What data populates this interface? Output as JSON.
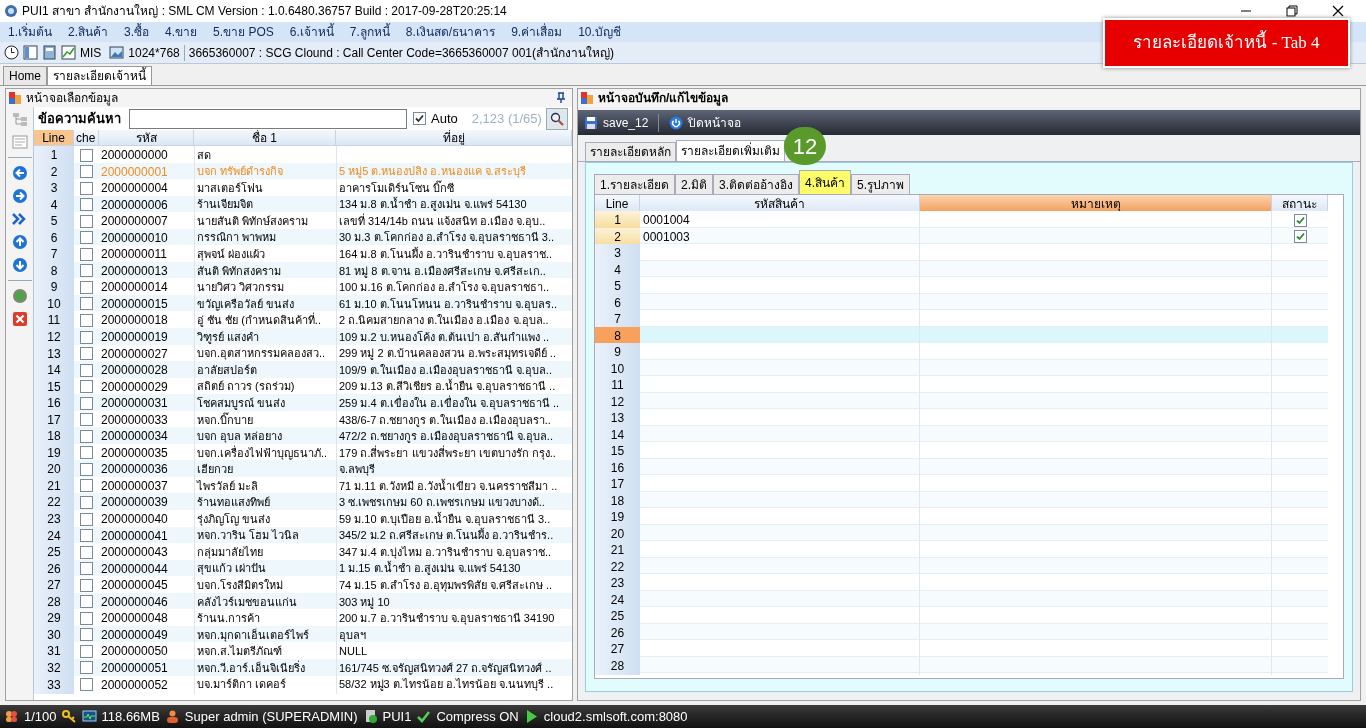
{
  "window": {
    "title": "PUI1 สาขา สำนักงานใหญ่ : SML CM Version : 1.0.6480.36757  Build : 2017-09-28T20:25:14"
  },
  "menu": [
    "1.เริ่มต้น",
    "2.สินค้า",
    "3.ซื้อ",
    "4.ขาย",
    "5.ขาย POS",
    "6.เจ้าหนี้",
    "7.ลูกหนี้",
    "8.เงินสด/ธนาคาร",
    "9.ค่าเสื่อม",
    "10.บัญชี"
  ],
  "toolbar": {
    "mis": "MIS",
    "resolution": "1024*768",
    "info": "3665360007 : SCG Clound : Call Center Code=3665360007 001(สำนักงานใหญ่)"
  },
  "banner": "รายละเอียดเจ้าหนี้ - Tab 4",
  "tabs": [
    {
      "label": "Home",
      "selected": false
    },
    {
      "label": "รายละเอียดเจ้าหนี้",
      "selected": true
    }
  ],
  "left_panel": {
    "title": "หน้าจอเลือกข้อมูล",
    "search_label": "ข้อความค้นหา",
    "auto": {
      "label": "Auto",
      "checked": true
    },
    "count": "2,123 (1/65)",
    "columns": [
      "Line",
      "che",
      "รหัส",
      "ชื่อ 1",
      "ที่อยู่"
    ],
    "rows": [
      {
        "line": "1",
        "code": "2000000000",
        "name": "สด",
        "checked": false,
        "selected": false
      },
      {
        "line": "2",
        "code": "2000000001",
        "name": "บจก ทรัพย์ดำรงกิจ",
        "address": "5 หมู่5 ต.หนองปลิง อ.หนองแค จ.สระบุรี",
        "checked": false,
        "selected": true
      },
      {
        "line": "3",
        "code": "2000000004",
        "name": "มาสเตอร์โฟน",
        "address": "อาคารโมเดิร์นโซน  บิ๊กซี",
        "checked": false,
        "selected": false
      },
      {
        "line": "4",
        "code": "2000000006",
        "name": "ร้านเจียมจิต",
        "address": "134 ม.8 ต.น้ำชำ อ.สูงเม่น จ.แพร่ 54130",
        "checked": false,
        "selected": false
      },
      {
        "line": "5",
        "code": "2000000007",
        "name": "นายสันติ พิทักษ์สงคราม",
        "address": "เลขที่ 314/14b ถนน แจ้งสนิท อ.เมือง จ.อุบ..",
        "checked": false,
        "selected": false
      },
      {
        "line": "6",
        "code": "2000000010",
        "name": "กรรณิกา พาพหม",
        "address": "30 ม.3 ต.โคกก่อง อ.สำโรง จ.อุบลราชธานี 3..",
        "checked": false,
        "selected": false
      },
      {
        "line": "7",
        "code": "2000000011",
        "name": "สุพจน์ ผ่องแผ้ว",
        "address": "164 ม.8  ต.โนนผึ้ง อ.วารินชำราบ จ.อุบลราช..",
        "checked": false,
        "selected": false
      },
      {
        "line": "8",
        "code": "2000000013",
        "name": "สันติ พิทักสงคราม",
        "address": "81 หมู่ 8 ต.จาน  อ.เมืองศรีสะเกษ  จ.ศรีสะเก..",
        "checked": false,
        "selected": false
      },
      {
        "line": "9",
        "code": "2000000014",
        "name": "นายวิศว วิศวกรรม",
        "address": "100 ม.16 ต.โคกก่อง อ.สำโรง จ.อุบลราชธา..",
        "checked": false,
        "selected": false
      },
      {
        "line": "10",
        "code": "2000000015",
        "name": "ขวัญเครือวัลย์ ขนส่ง",
        "address": "61 ม.10 ต.โนนโหนน อ.วารินชำราบ จ.อุบลร..",
        "checked": false,
        "selected": false
      },
      {
        "line": "11",
        "code": "2000000018",
        "name": "อู่ ชัน ชัย (กำหนดสินค้าที่..",
        "address": "2 ถ.นิคมสายกลาง ต.ในเมือง อ.เมือง จ.อุบล..",
        "checked": false,
        "selected": false
      },
      {
        "line": "12",
        "code": "2000000019",
        "name": "วิฑูรย์ แสงคำ",
        "address": "109 ม.2 บ.หนองโค้ง ต.ต้นเปา อ.สันกำแพง ..",
        "checked": false,
        "selected": false
      },
      {
        "line": "13",
        "code": "2000000027",
        "name": "บจก.อุตสาหกรรมคลองสว..",
        "address": "299 หมู่ 2 ต.บ้านคลองสวน อ.พระสมุทรเจดีย์ ..",
        "checked": false,
        "selected": false
      },
      {
        "line": "14",
        "code": "2000000028",
        "name": "อาลัยสปอร์ต",
        "address": "109/9 ต.ในเมือง อ.เมืองอุบลราชธานี จ.อุบล..",
        "checked": false,
        "selected": false
      },
      {
        "line": "15",
        "code": "2000000029",
        "name": "สถิตย์ ถาวร (รถร่วม)",
        "address": "209 ม.13 ต.สีวิเชียร อ.น้ำยืน จ.อุบลราชธานี ..",
        "checked": false,
        "selected": false
      },
      {
        "line": "16",
        "code": "2000000031",
        "name": "โชคสมบูรณ์ ขนส่ง",
        "address": "259 ม.4 ต.เขื่องใน อ.เขื่องใน จ.อุบลราชธานี ..",
        "checked": false,
        "selected": false
      },
      {
        "line": "17",
        "code": "2000000033",
        "name": "หจก.บิ๊กบาย",
        "address": "438/6-7 ถ.ชยางกูร ต.ในเมือง อ.เมืองอุบลรา..",
        "checked": false,
        "selected": false
      },
      {
        "line": "18",
        "code": "2000000034",
        "name": "บจก อุบล หล่อยาง",
        "address": "472/2 ถ.ชยางกูร อ.เมืองอุบลราชธานี จ.อุบล..",
        "checked": false,
        "selected": false
      },
      {
        "line": "19",
        "code": "2000000035",
        "name": "บจก.เครื่องไฟฟ้าบุญธนาภั..",
        "address": "179 ถ.สี่พระยา แขวงสี่พระยา เขตบางรัก กรุง..",
        "checked": false,
        "selected": false
      },
      {
        "line": "20",
        "code": "2000000036",
        "name": "เฮียกวย",
        "address": "จ.ลพบุรี",
        "checked": false,
        "selected": false
      },
      {
        "line": "21",
        "code": "2000000037",
        "name": "ไพรวัลย์ มะลิ",
        "address": "71 ม.11 ต.วังหมี อ.วังน้ำเขียว จ.นครราชสีมา ..",
        "checked": false,
        "selected": false
      },
      {
        "line": "22",
        "code": "2000000039",
        "name": "ร้านทอแสงทิพย์",
        "address": "3 ซ.เพชรเกษม 60 ถ.เพชรเกษม แขวงบางด้..",
        "checked": false,
        "selected": false
      },
      {
        "line": "23",
        "code": "2000000040",
        "name": "รุ่งภิญโญ ขนส่ง",
        "address": "59 ม.10 ต.บุเปือย อ.น้ำยืน จ.อุบลราชธานี 3..",
        "checked": false,
        "selected": false
      },
      {
        "line": "24",
        "code": "2000000041",
        "name": "หจก.วาริน โฮม ไวนิล",
        "address": "345/2 ม.2 ถ.ศรีสะเกษ ต.โนนผึ้ง อ.วารินชำร..",
        "checked": false,
        "selected": false
      },
      {
        "line": "25",
        "code": "2000000043",
        "name": "กลุ่มมาลัยไทย",
        "address": "347 ม.4 ต.บุ่งไหม อ.วารินชำราบ จ.อุบลราช..",
        "checked": false,
        "selected": false
      },
      {
        "line": "26",
        "code": "2000000044",
        "name": "สุขแก้ว เผ่าปัน",
        "address": "1 ม.15 ต.น้ำชำ อ.สูงเม่น จ.แพร่ 54130",
        "checked": false,
        "selected": false
      },
      {
        "line": "27",
        "code": "2000000045",
        "name": "บจก.โรงสีมิตรใหม่",
        "address": "74 ม.15 ต.สำโรง อ.อุทุมพรพิสัย จ.ศรีสะเกษ ..",
        "checked": false,
        "selected": false
      },
      {
        "line": "28",
        "code": "2000000046",
        "name": "คลังไวร์เมชขอนแก่น",
        "address": "303 หมู่ 10",
        "checked": false,
        "selected": false
      },
      {
        "line": "29",
        "code": "2000000048",
        "name": "ร้านน.การค้า",
        "address": "200 ม.7 อ.วารินชำราบ จ.อุบลราชธานี 34190",
        "checked": false,
        "selected": false
      },
      {
        "line": "30",
        "code": "2000000049",
        "name": "หจก.มุกดาเอ็นเตอร์ไพร์",
        "address": "อุบลฯ",
        "checked": false,
        "selected": false
      },
      {
        "line": "31",
        "code": "2000000050",
        "name": "หจก.ส.ไมตรีภัณฑ์",
        "address": "NULL",
        "checked": false,
        "selected": false
      },
      {
        "line": "32",
        "code": "2000000051",
        "name": "หจก.วี.อาร์.เอ็นจิเนียริ่ง",
        "address": "161/745 ซ.จรัญสนิทวงศ์ 27 ถ.จรัญสนิทวงศ์ ..",
        "checked": false,
        "selected": false
      },
      {
        "line": "33",
        "code": "2000000052",
        "name": "บจ.มาร์ติกา เดคอร์",
        "address": "58/32 หมู่3 ต.ไทรน้อย อ.ไทรน้อย จ.นนทบุรี ..",
        "checked": false,
        "selected": false
      }
    ]
  },
  "right_panel": {
    "title": "หน้าจอบันทึก/แก้ไขข้อมูล",
    "buttons": [
      "save_12",
      "ปิดหน้าจอ"
    ],
    "tabs": [
      {
        "label": "รายละเอียดหลัก",
        "selected": false
      },
      {
        "label": "รายละเอียดเพิ่มเติม",
        "selected": true
      }
    ],
    "badge": "12",
    "sub_tabs": [
      {
        "label": "1.รายละเอียด",
        "selected": false
      },
      {
        "label": "2.มิติ",
        "selected": false
      },
      {
        "label": "3.ติดต่ออ้างอิง",
        "selected": false
      },
      {
        "label": "4.สินค้า",
        "selected": true
      },
      {
        "label": "5.รูปภาพ",
        "selected": false
      }
    ],
    "columns": [
      "Line",
      "รหัสสินค้า",
      "หมายเหตุ",
      "สถานะ"
    ],
    "rows": [
      {
        "line": "1",
        "code": "0001004",
        "status": true,
        "selected": false
      },
      {
        "line": "2",
        "code": "0001003",
        "status": true,
        "selected": false
      },
      {
        "line": "3",
        "selected": false
      },
      {
        "line": "4",
        "selected": false
      },
      {
        "line": "5",
        "selected": false
      },
      {
        "line": "6",
        "selected": false
      },
      {
        "line": "7",
        "selected": false
      },
      {
        "line": "8",
        "selected": true
      },
      {
        "line": "9",
        "selected": false
      },
      {
        "line": "10",
        "selected": false
      },
      {
        "line": "11",
        "selected": false
      },
      {
        "line": "12",
        "selected": false
      },
      {
        "line": "13",
        "selected": false
      },
      {
        "line": "14",
        "selected": false
      },
      {
        "line": "15",
        "selected": false
      },
      {
        "line": "16",
        "selected": false
      },
      {
        "line": "17",
        "selected": false
      },
      {
        "line": "18",
        "selected": false
      },
      {
        "line": "19",
        "selected": false
      },
      {
        "line": "20",
        "selected": false
      },
      {
        "line": "21",
        "selected": false
      },
      {
        "line": "22",
        "selected": false
      },
      {
        "line": "23",
        "selected": false
      },
      {
        "line": "24",
        "selected": false
      },
      {
        "line": "25",
        "selected": false
      },
      {
        "line": "26",
        "selected": false
      },
      {
        "line": "27",
        "selected": false
      },
      {
        "line": "28",
        "selected": false
      }
    ]
  },
  "status_bar": [
    "1/100",
    "118.66MB",
    "Super admin (SUPERADMIN)",
    "PUI1",
    "Compress ON",
    "cloud2.smlsoft.com:8080"
  ]
}
